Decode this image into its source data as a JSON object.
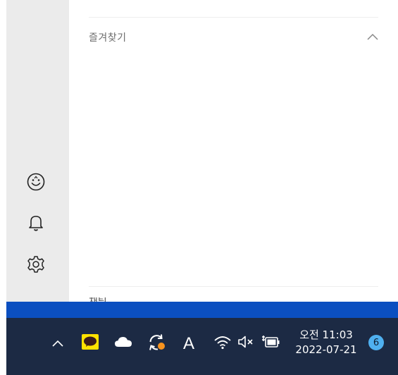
{
  "favorites_section": {
    "title": "즐겨찾기",
    "expanded": true
  },
  "next_section": {
    "title_partial": "채팅"
  },
  "rail": {
    "items": [
      {
        "name": "emoji",
        "icon": "smiley-icon"
      },
      {
        "name": "notifications",
        "icon": "bell-icon"
      },
      {
        "name": "settings",
        "icon": "gear-icon"
      }
    ]
  },
  "taskbar": {
    "ime_label": "A",
    "clock": {
      "time": "오전 11:03",
      "date": "2022-07-21"
    },
    "notification_count": "6",
    "colors": {
      "taskbar_bg": "#1c2a44",
      "strip_blue": "#0b4fc0",
      "badge": "#4fb0f0",
      "kakao_yellow": "#ffe200",
      "sync_orange": "#f7931e"
    }
  }
}
